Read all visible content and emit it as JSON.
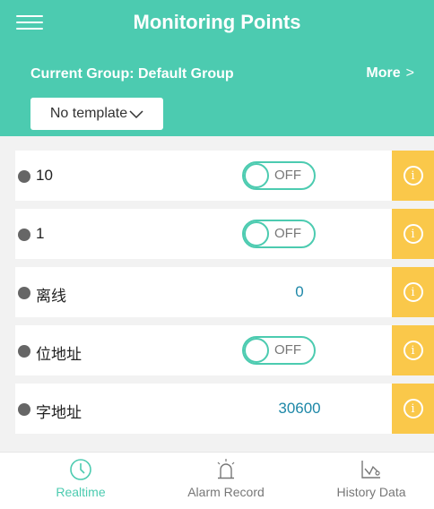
{
  "header": {
    "title": "Monitoring Points",
    "group_label": "Current Group: Default Group",
    "more_label": "More",
    "more_chevron": ">",
    "template_value": "No template"
  },
  "points": [
    {
      "name": "10",
      "control": "toggle",
      "toggle_text": "OFF",
      "info_icon": "i"
    },
    {
      "name": "1",
      "control": "toggle",
      "toggle_text": "OFF",
      "info_icon": "i"
    },
    {
      "name": "离线",
      "control": "value",
      "value": "0",
      "info_icon": "i"
    },
    {
      "name": "位地址",
      "control": "toggle",
      "toggle_text": "OFF",
      "info_icon": "i"
    },
    {
      "name": "字地址",
      "control": "value",
      "value": "30600",
      "info_icon": "i"
    }
  ],
  "tabs": [
    {
      "label": "Realtime",
      "icon": "clock-icon",
      "active": true
    },
    {
      "label": "Alarm Record",
      "icon": "alarm-light-icon",
      "active": false
    },
    {
      "label": "History Data",
      "icon": "line-chart-icon",
      "active": false
    }
  ],
  "colors": {
    "primary": "#4ccbb0",
    "info_button": "#fac84a",
    "status_dot": "#666666",
    "value_text": "#1e88a8"
  }
}
